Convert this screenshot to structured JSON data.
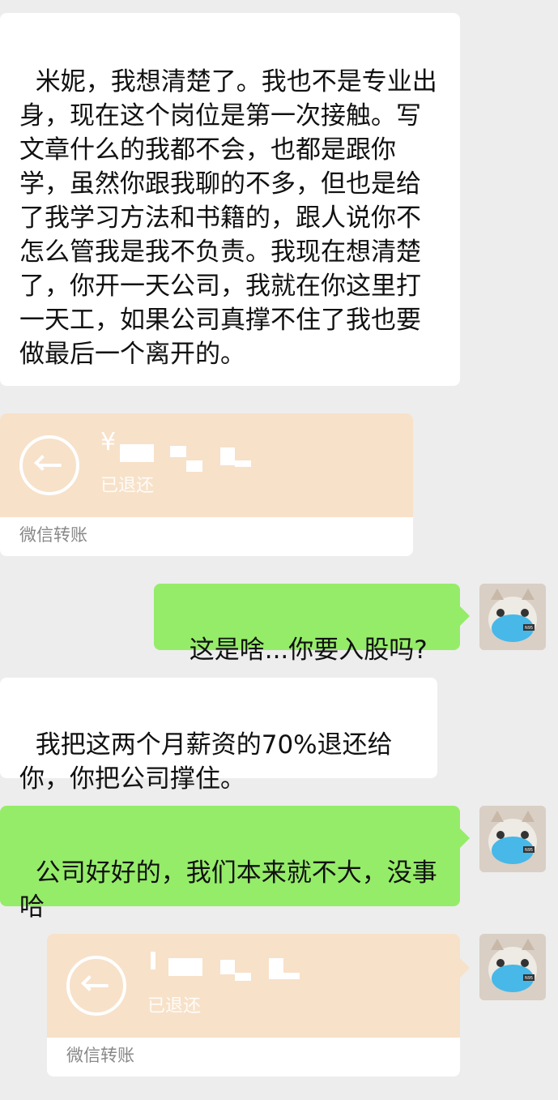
{
  "messages": {
    "m1": "米妮，我想清楚了。我也不是专业出身，现在这个岗位是第一次接触。写文章什么的我都不会，也都是跟你学，虽然你跟我聊的不多，但也是给了我学习方法和书籍的，跟人说你不怎么管我是我不负责。我现在想清楚了，你开一天公司，我就在你这里打一天工，如果公司真撑不住了我也要做最后一个离开的。",
    "m3": "这是啥...你要入股吗?",
    "m4": "我把这两个月薪资的70%退还给你，你把公司撑住。",
    "m5": "公司好好的，我们本来就不大，没事哈"
  },
  "transfer1": {
    "currency": "¥",
    "status": "已退还",
    "footer": "微信转账"
  },
  "transfer2": {
    "status": "已退还",
    "footer": "微信转账"
  },
  "avatar": {
    "badge": "N95"
  },
  "colors": {
    "incoming": "#ffffff",
    "outgoing": "#95ec69",
    "transfer": "#f7e1c9",
    "background": "#ededed"
  }
}
